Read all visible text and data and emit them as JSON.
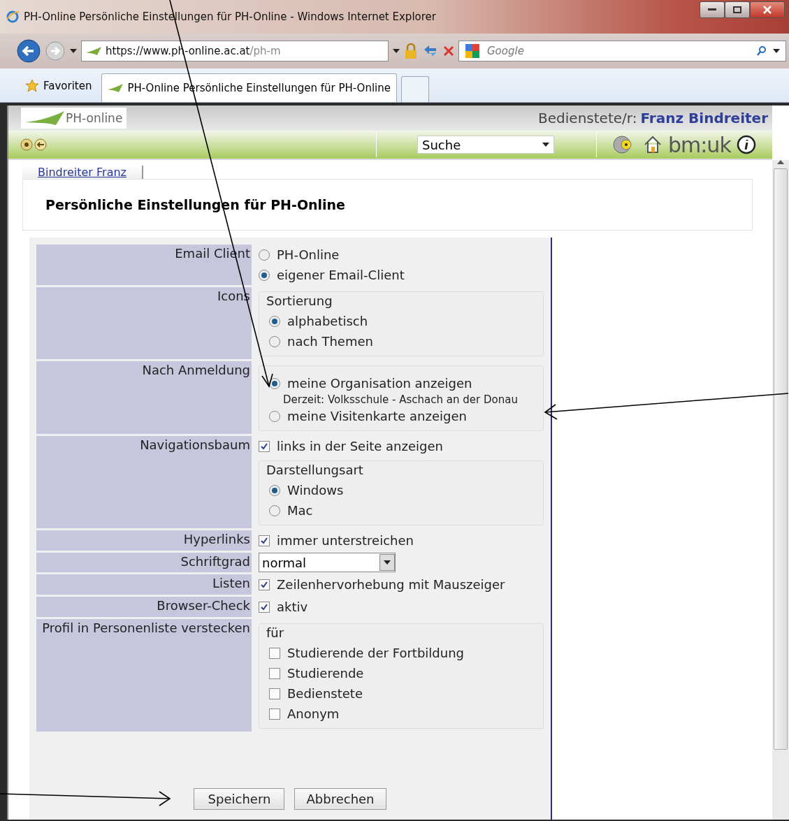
{
  "window": {
    "title": "PH-Online Persönliche Einstellungen für PH-Online - Windows Internet Explorer"
  },
  "address_bar": {
    "url_host": "https://www.ph-online.ac.at",
    "url_path": "/ph-m",
    "search_placeholder": "Google"
  },
  "favorites_label": "Favoriten",
  "tabs": [
    {
      "label": "PH-Online Persönliche Einstellungen für PH-Online",
      "selected": true
    }
  ],
  "header": {
    "logo_text": "PH-online",
    "user_role": "Bedienstete/r:",
    "user_name": "Franz Bindreiter",
    "search_select": "Suche",
    "brand": "bm:uk"
  },
  "breadcrumb": "Bindreiter Franz",
  "heading": "Persönliche Einstellungen für PH-Online",
  "settings": [
    {
      "label": "Email Client",
      "items": [
        {
          "kind": "radio",
          "label": "PH-Online",
          "selected": false
        },
        {
          "kind": "radio",
          "label": "eigener Email-Client",
          "selected": true
        }
      ]
    },
    {
      "label": "Icons",
      "items": [
        {
          "kind": "group",
          "legend": "Sortierung",
          "items": [
            {
              "kind": "radio",
              "label": "alphabetisch",
              "selected": true
            },
            {
              "kind": "radio",
              "label": "nach Themen",
              "selected": false
            }
          ]
        }
      ]
    },
    {
      "label": "Nach Anmeldung",
      "items": [
        {
          "kind": "group",
          "items": [
            {
              "kind": "radio",
              "label": "meine Organisation anzeigen",
              "selected": true
            },
            {
              "kind": "note",
              "text": "Derzeit: Volksschule - Aschach an der Donau"
            },
            {
              "kind": "radio",
              "label": "meine Visitenkarte anzeigen",
              "selected": false
            }
          ]
        }
      ]
    },
    {
      "label": "Navigationsbaum",
      "items": [
        {
          "kind": "checkbox",
          "label": "links in der Seite anzeigen",
          "checked": true
        },
        {
          "kind": "group",
          "legend": "Darstellungsart",
          "items": [
            {
              "kind": "radio",
              "label": "Windows",
              "selected": true
            },
            {
              "kind": "radio",
              "label": "Mac",
              "selected": false
            }
          ]
        }
      ]
    },
    {
      "label": "Hyperlinks",
      "items": [
        {
          "kind": "checkbox",
          "label": "immer unterstreichen",
          "checked": true
        }
      ]
    },
    {
      "label": "Schriftgrad",
      "items": [
        {
          "kind": "select",
          "value": "normal"
        }
      ]
    },
    {
      "label": "Listen",
      "items": [
        {
          "kind": "checkbox",
          "label": "Zeilenhervorhebung mit Mauszeiger",
          "checked": true
        }
      ]
    },
    {
      "label": "Browser-Check",
      "items": [
        {
          "kind": "checkbox",
          "label": "aktiv",
          "checked": true
        }
      ]
    },
    {
      "label": "Profil in Personenliste verstecken",
      "items": [
        {
          "kind": "group",
          "legend": "für",
          "items": [
            {
              "kind": "checkbox",
              "label": "Studierende der Fortbildung",
              "checked": false
            },
            {
              "kind": "checkbox",
              "label": "Studierende",
              "checked": false
            },
            {
              "kind": "checkbox",
              "label": "Bedienstete",
              "checked": false
            },
            {
              "kind": "checkbox",
              "label": "Anonym",
              "checked": false
            }
          ]
        }
      ]
    }
  ],
  "buttons": [
    "Speichern",
    "Abbrechen"
  ]
}
